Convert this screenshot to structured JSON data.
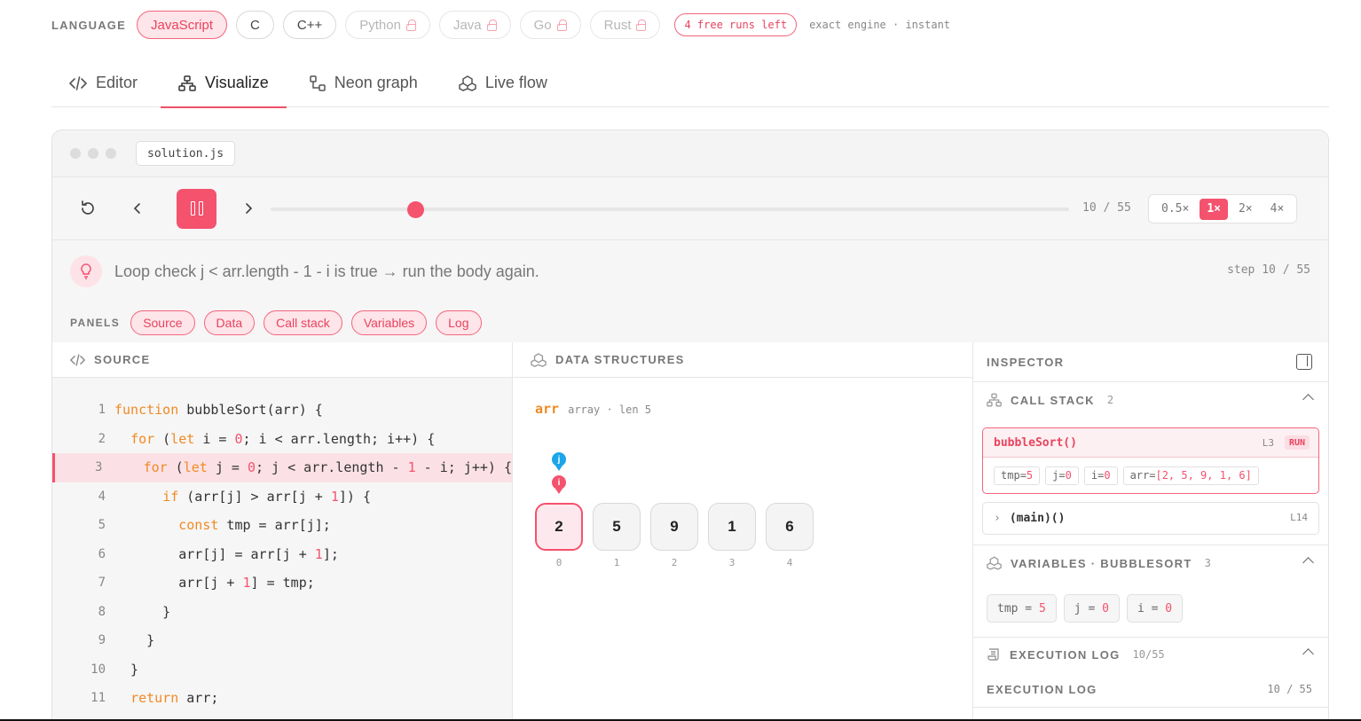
{
  "language": {
    "label": "LANGUAGE",
    "options": [
      {
        "name": "JavaScript",
        "state": "active"
      },
      {
        "name": "C",
        "state": "available"
      },
      {
        "name": "C++",
        "state": "available"
      },
      {
        "name": "Python",
        "state": "locked"
      },
      {
        "name": "Java",
        "state": "locked"
      },
      {
        "name": "Go",
        "state": "locked"
      },
      {
        "name": "Rust",
        "state": "locked"
      }
    ],
    "free_runs": "4 free runs left",
    "engine_note": "exact engine · instant"
  },
  "tabs": [
    {
      "label": "Editor",
      "icon": "code-icon"
    },
    {
      "label": "Visualize",
      "icon": "hierarchy-icon",
      "active": true
    },
    {
      "label": "Neon graph",
      "icon": "graph-icon"
    },
    {
      "label": "Live flow",
      "icon": "flow-icon"
    }
  ],
  "window": {
    "filename": "solution.js"
  },
  "player": {
    "current_step": 10,
    "total_steps": 55,
    "step_label": "10 / 55",
    "speeds": [
      "0.5×",
      "1×",
      "2×",
      "4×"
    ],
    "active_speed": "1×",
    "accent": "#f4526d"
  },
  "hint": {
    "text": "Loop check j < arr.length - 1 - i is true → run the body again.",
    "step_text": "step 10 / 55"
  },
  "panels": {
    "label": "PANELS",
    "items": [
      "Source",
      "Data",
      "Call stack",
      "Variables",
      "Log"
    ]
  },
  "source": {
    "title": "SOURCE",
    "highlight_line": 3,
    "lines": [
      "1",
      "2",
      "3",
      "4",
      "5",
      "6",
      "7",
      "8",
      "9",
      "10",
      "11"
    ]
  },
  "data_structures": {
    "title": "DATA STRUCTURES",
    "array_name": "arr",
    "array_meta": "array · len 5",
    "values": [
      "2",
      "5",
      "9",
      "1",
      "6"
    ],
    "indices": [
      "0",
      "1",
      "2",
      "3",
      "4"
    ],
    "pointer_j": "j",
    "pointer_i": "i",
    "active_index": 0
  },
  "inspector": {
    "title": "INSPECTOR",
    "call_stack": {
      "title": "CALL STACK",
      "count": "2",
      "frames": [
        {
          "name": "bubbleSort()",
          "line": "L3",
          "badge": "RUN"
        },
        {
          "name": "(main)()",
          "line": "L14"
        }
      ],
      "frame_vars": [
        {
          "k": "tmp",
          "v": "5"
        },
        {
          "k": "j",
          "v": "0"
        },
        {
          "k": "i",
          "v": "0"
        },
        {
          "k": "arr",
          "v": "[2, 5, 9, 1, 6]"
        }
      ]
    },
    "variables": {
      "title": "VARIABLES · BUBBLESORT",
      "count": "3",
      "items": [
        {
          "k": "tmp",
          "v": "5"
        },
        {
          "k": "j",
          "v": "0"
        },
        {
          "k": "i",
          "v": "0"
        }
      ]
    },
    "execution_log": {
      "title": "EXECUTION LOG",
      "count": "10/55",
      "sub_title": "EXECUTION LOG",
      "sub_count": "10 / 55"
    }
  }
}
